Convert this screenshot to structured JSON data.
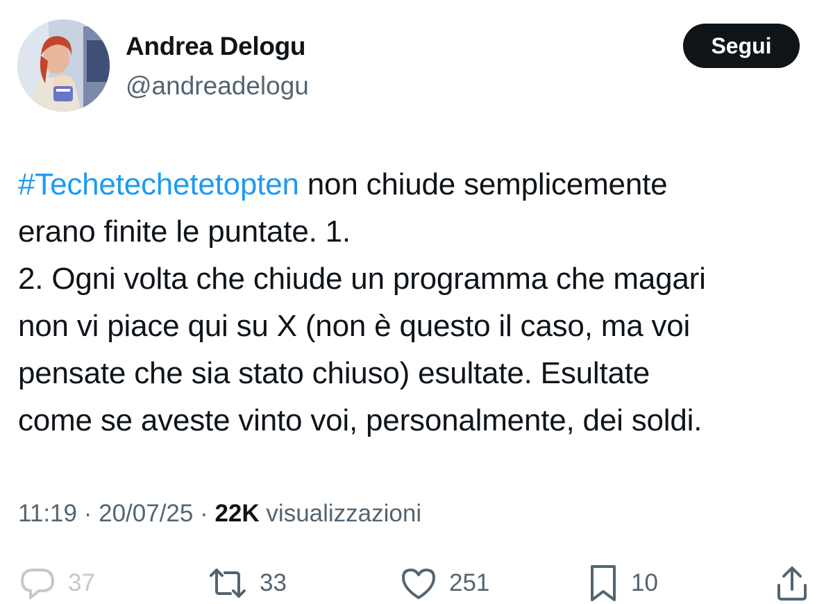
{
  "tweet": {
    "author": {
      "display_name": "Andrea Delogu",
      "handle": "@andreadelogu"
    },
    "follow_button_label": "Segui",
    "text": {
      "hashtag": "#Techetechetetopten",
      "line1_rest": " non chiude semplicemente",
      "line2": "erano finite le puntate. 1.",
      "line3": "2. Ogni volta che chiude un programma che magari",
      "line4": "non vi piace qui su X (non è questo il caso, ma voi",
      "line5": "pensate che sia stato chiuso) esultate. Esultate",
      "line6": "come se aveste vinto voi, personalmente, dei soldi."
    },
    "meta": {
      "time": "11:19",
      "separator": " · ",
      "date": "20/07/25",
      "views_count": "22K",
      "views_label": " visualizzazioni"
    },
    "actions": {
      "replies": {
        "icon": "reply-icon",
        "count": "37"
      },
      "reposts": {
        "icon": "repost-icon",
        "count": "33"
      },
      "likes": {
        "icon": "heart-icon",
        "count": "251"
      },
      "bookmarks": {
        "icon": "bookmark-icon",
        "count": "10"
      },
      "share": {
        "icon": "share-icon"
      }
    }
  },
  "colors": {
    "text": "#0f1419",
    "secondary": "#536471",
    "link": "#1d9bf0",
    "button_bg": "#0f1419",
    "button_text": "#ffffff"
  }
}
